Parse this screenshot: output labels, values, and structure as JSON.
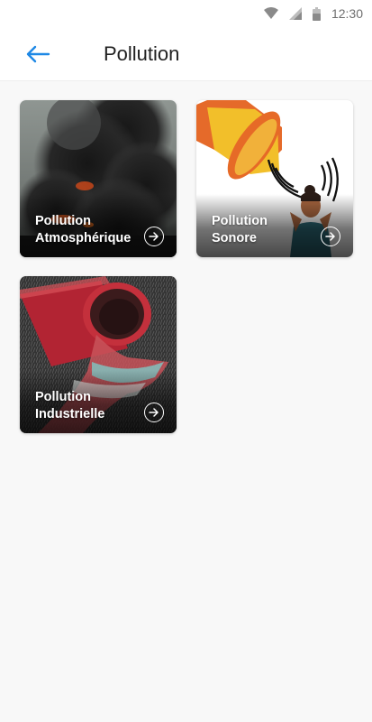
{
  "status_bar": {
    "time": "12:30",
    "icons": [
      "wifi-icon",
      "signal-icon",
      "battery-icon"
    ]
  },
  "header": {
    "back_icon": "arrow-left-icon",
    "title": "Pollution",
    "accent_color": "#1e88e5"
  },
  "cards": [
    {
      "line1": "Pollution",
      "line2": "Atmosphérique",
      "image": "smoke-fire-photo",
      "arrow_icon": "arrow-right-circle-icon"
    },
    {
      "line1": "Pollution",
      "line2": "Sonore",
      "image": "megaphone-noise-illustration",
      "arrow_icon": "arrow-right-circle-icon"
    },
    {
      "line1": "Pollution",
      "line2": "Industrielle",
      "image": "drain-pipe-photo",
      "arrow_icon": "arrow-right-circle-icon"
    }
  ]
}
